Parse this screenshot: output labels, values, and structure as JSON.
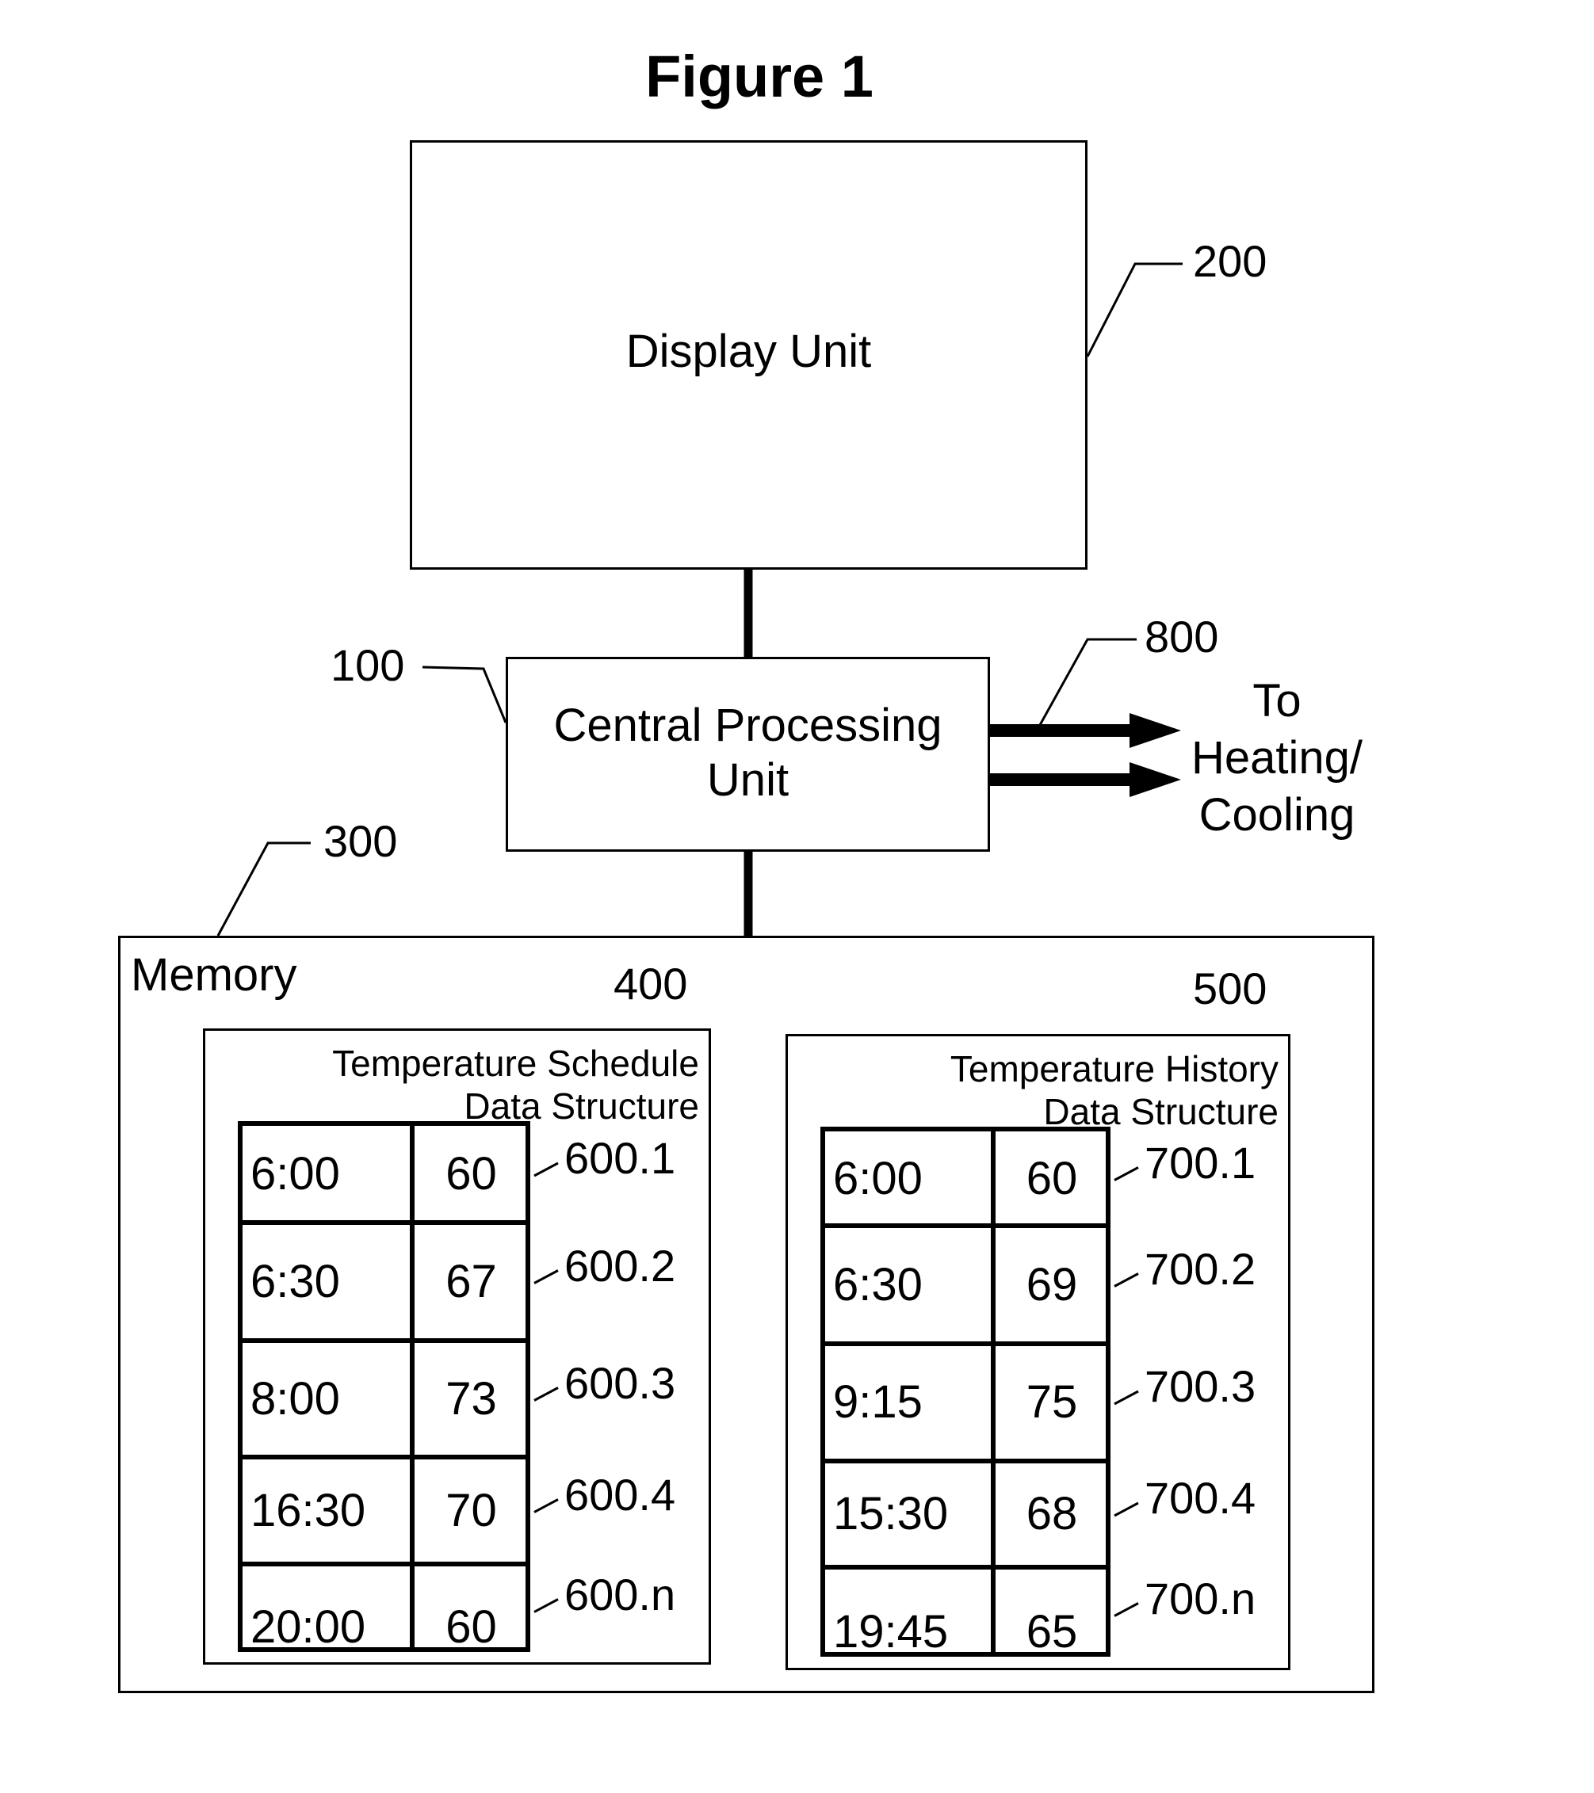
{
  "figure": {
    "title": "Figure 1"
  },
  "display_unit": {
    "label": "Display Unit",
    "ref": "200"
  },
  "cpu": {
    "label_line1": "Central Processing",
    "label_line2": "Unit",
    "ref": "100"
  },
  "output": {
    "ref": "800",
    "line1": "To",
    "line2": "Heating/",
    "line3": "Cooling"
  },
  "memory": {
    "label": "Memory",
    "ref": "300"
  },
  "schedule": {
    "ref": "400",
    "title_line1": "Temperature Schedule",
    "title_line2": "Data Structure",
    "rows": [
      {
        "time": "6:00",
        "temp": "60",
        "ref": "600.1"
      },
      {
        "time": "6:30",
        "temp": "67",
        "ref": "600.2"
      },
      {
        "time": "8:00",
        "temp": "73",
        "ref": "600.3"
      },
      {
        "time": "16:30",
        "temp": "70",
        "ref": "600.4"
      },
      {
        "time": "20:00",
        "temp": "60",
        "ref": "600.n"
      }
    ]
  },
  "history": {
    "ref": "500",
    "title_line1": "Temperature History",
    "title_line2": "Data Structure",
    "rows": [
      {
        "time": "6:00",
        "temp": "60",
        "ref": "700.1"
      },
      {
        "time": "6:30",
        "temp": "69",
        "ref": "700.2"
      },
      {
        "time": "9:15",
        "temp": "75",
        "ref": "700.3"
      },
      {
        "time": "15:30",
        "temp": "68",
        "ref": "700.4"
      },
      {
        "time": "19:45",
        "temp": "65",
        "ref": "700.n"
      }
    ]
  }
}
